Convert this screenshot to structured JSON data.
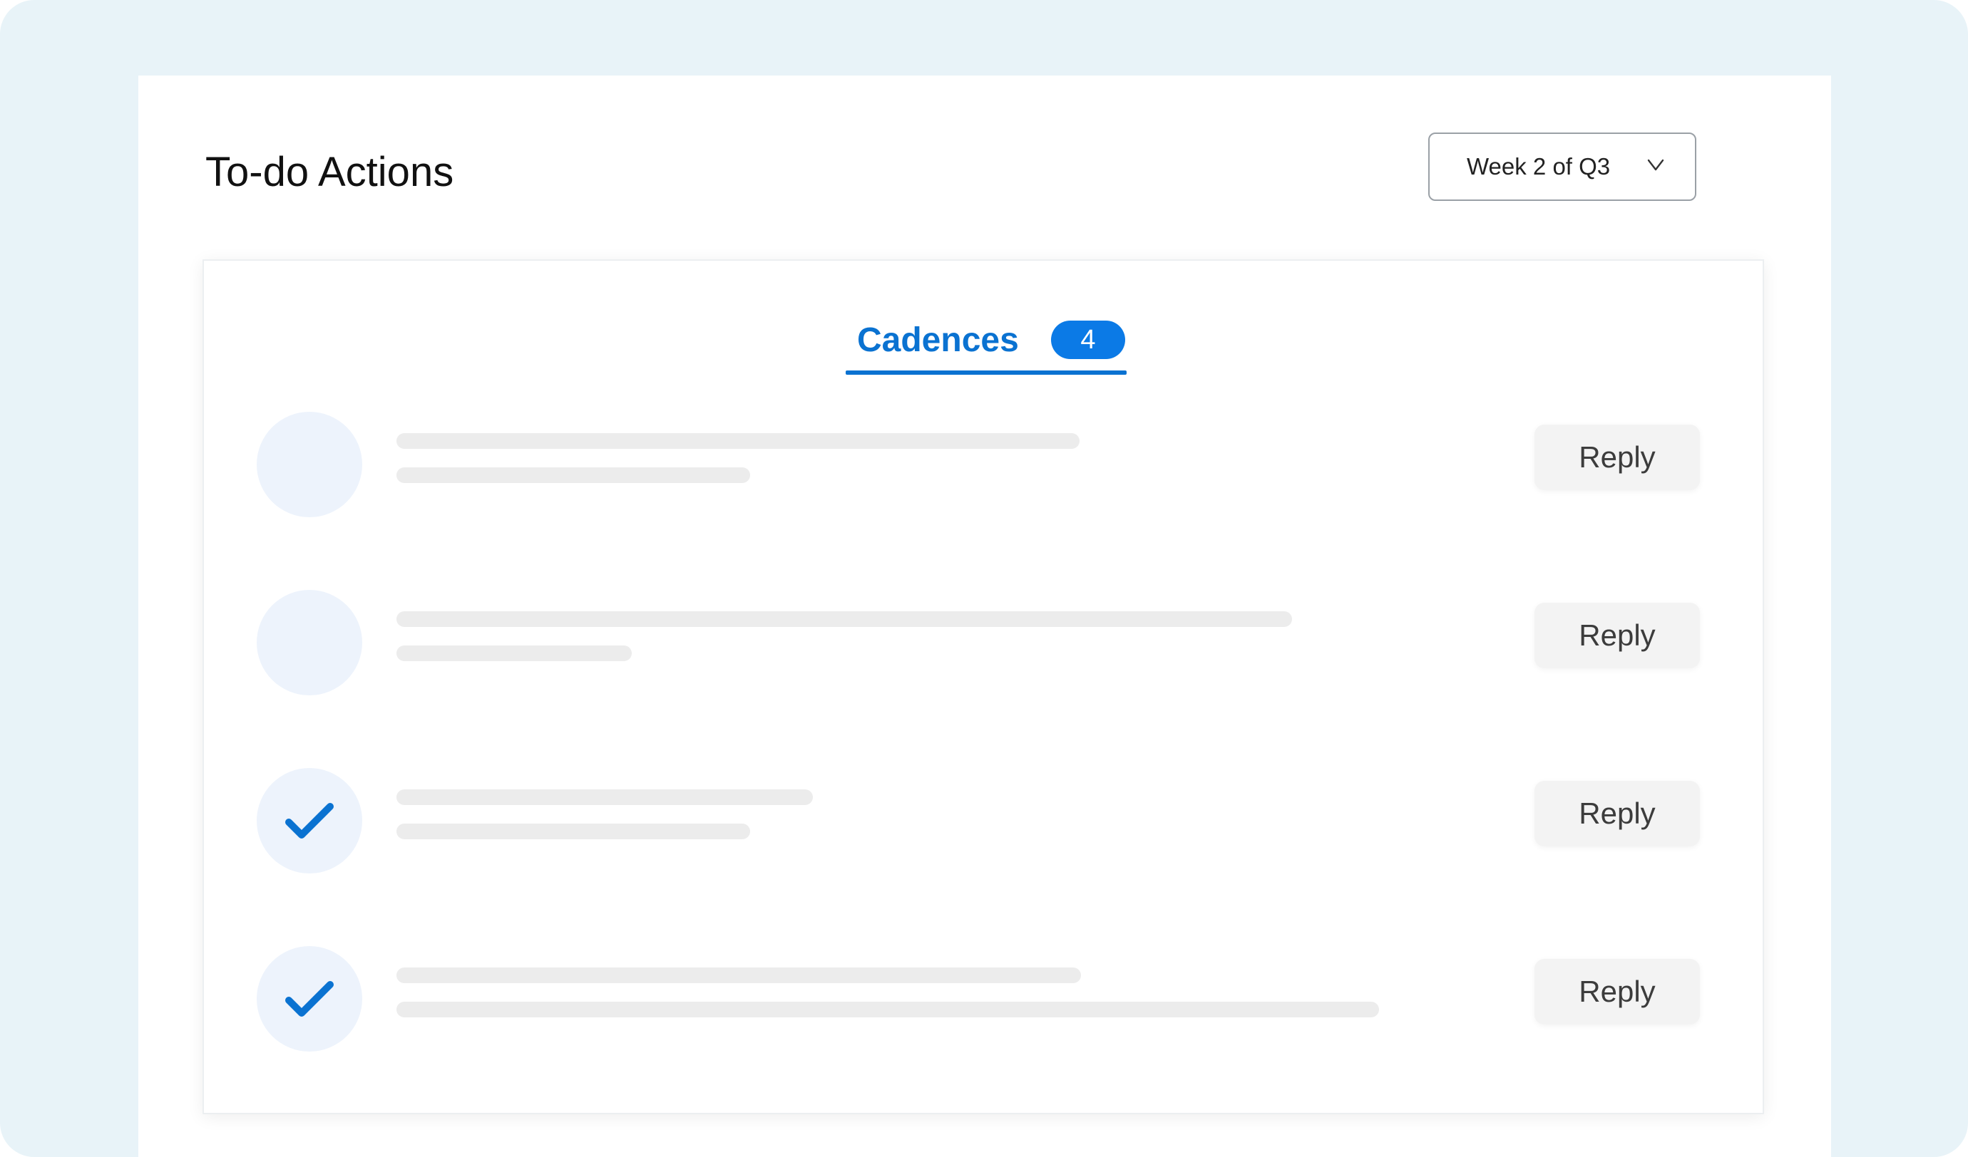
{
  "header": {
    "title": "To-do Actions",
    "week_select": {
      "selected": "Week 2 of Q3",
      "chevron_icon": "chevron-down-icon"
    }
  },
  "tabs": [
    {
      "label": "Cadences",
      "badge": "4",
      "active": true
    }
  ],
  "rows": [
    {
      "status_icon": "empty-avatar",
      "completed": false,
      "action_label": "Reply"
    },
    {
      "status_icon": "empty-avatar",
      "completed": false,
      "action_label": "Reply"
    },
    {
      "status_icon": "check-icon",
      "completed": true,
      "action_label": "Reply"
    },
    {
      "status_icon": "check-icon",
      "completed": true,
      "action_label": "Reply"
    }
  ],
  "colors": {
    "accent": "#0a72d1",
    "badge": "#0b7ae6",
    "background": "#e8f3f8",
    "avatar": "#edf3fc",
    "skeleton": "#ececec"
  }
}
